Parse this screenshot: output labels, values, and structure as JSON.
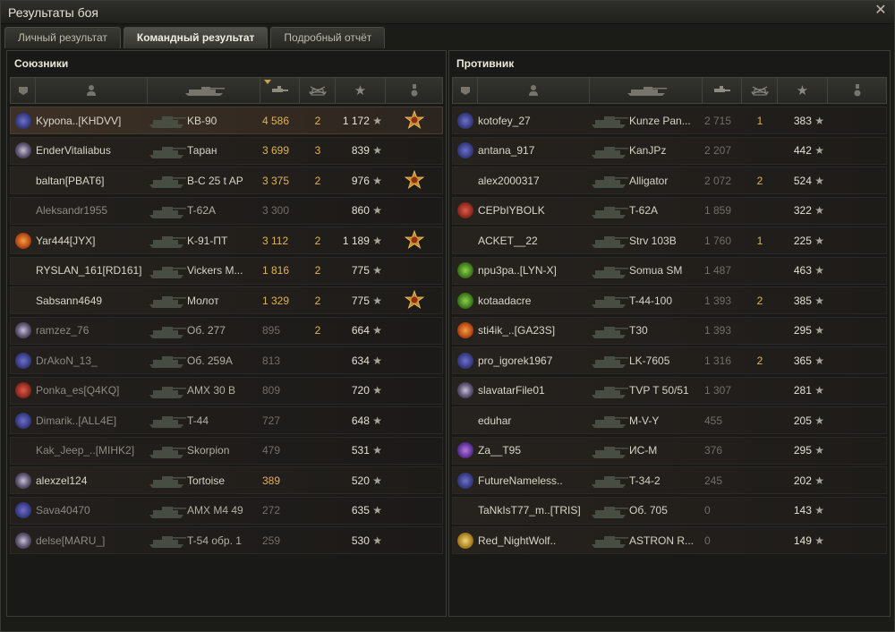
{
  "window": {
    "title": "Результаты боя"
  },
  "tabs": [
    {
      "label": "Личный результат",
      "active": false
    },
    {
      "label": "Командный результат",
      "active": true
    },
    {
      "label": "Подробный отчёт",
      "active": false
    }
  ],
  "colors": {
    "accent": "#e3b34f",
    "highlight": "#3d3126"
  },
  "allies": {
    "title": "Союзники",
    "players": [
      {
        "name": "Kypona..[KHDVV]",
        "tank": "KB-90",
        "damage": "4 586",
        "kills": "2",
        "xp": "1 172",
        "medal": true,
        "badge": "clan",
        "hl": true,
        "dmg_gold": true
      },
      {
        "name": "EnderVitaliabus",
        "tank": "Таран",
        "damage": "3 699",
        "kills": "3",
        "xp": "839",
        "medal": false,
        "badge": "diamond",
        "hl": false,
        "dmg_gold": true
      },
      {
        "name": "baltan[PBAT6]",
        "tank": "B-C 25 t AP",
        "damage": "3 375",
        "kills": "2",
        "xp": "976",
        "medal": true,
        "badge": "",
        "hl": false,
        "dmg_gold": true
      },
      {
        "name": "Aleksandr1955",
        "tank": "T-62A",
        "damage": "3 300",
        "kills": "",
        "xp": "860",
        "medal": false,
        "badge": "",
        "dim": true,
        "dmg_gold": false
      },
      {
        "name": "Yar444[JYX]",
        "tank": "K-91-ПТ",
        "damage": "3 112",
        "kills": "2",
        "xp": "1 189",
        "medal": true,
        "badge": "flame",
        "hl": false,
        "dmg_gold": true
      },
      {
        "name": "RYSLAN_161[RD161]",
        "tank": "Vickers M...",
        "damage": "1 816",
        "kills": "2",
        "xp": "775",
        "medal": false,
        "badge": "",
        "hl": false,
        "dmg_gold": true
      },
      {
        "name": "Sabsann4649",
        "tank": "Молот",
        "damage": "1 329",
        "kills": "2",
        "xp": "775",
        "medal": true,
        "badge": "",
        "hl": false,
        "dmg_gold": true
      },
      {
        "name": "ramzez_76",
        "tank": "Об. 277",
        "damage": "895",
        "kills": "2",
        "xp": "664",
        "medal": false,
        "badge": "diamond",
        "dim": true,
        "red": true,
        "dmg_gold": false
      },
      {
        "name": "DrAkoN_13_",
        "tank": "Об. 259А",
        "damage": "813",
        "kills": "",
        "xp": "634",
        "medal": false,
        "badge": "clan",
        "dim": true,
        "dmg_gold": false
      },
      {
        "name": "Ponka_es[Q4KQ]",
        "tank": "AMX 30 B",
        "damage": "809",
        "kills": "",
        "xp": "720",
        "medal": false,
        "badge": "red",
        "dim": true,
        "red": true,
        "dmg_gold": false
      },
      {
        "name": "Dimarik..[ALL4E]",
        "tank": "T-44",
        "damage": "727",
        "kills": "",
        "xp": "648",
        "medal": false,
        "badge": "clan",
        "dim": true,
        "dmg_gold": false
      },
      {
        "name": "Kak_Jeep_..[MIHK2]",
        "tank": "Skorpion",
        "damage": "479",
        "kills": "",
        "xp": "531",
        "medal": false,
        "badge": "",
        "dim": true,
        "red": true,
        "dmg_gold": false
      },
      {
        "name": "alexzel124",
        "tank": "Tortoise",
        "damage": "389",
        "kills": "",
        "xp": "520",
        "medal": false,
        "badge": "diamond",
        "hl": false,
        "dmg_gold": true
      },
      {
        "name": "Sava40470",
        "tank": "AMX M4 49",
        "damage": "272",
        "kills": "",
        "xp": "635",
        "medal": false,
        "badge": "clan",
        "dim": true,
        "dmg_gold": false
      },
      {
        "name": "delse[MARU_]",
        "tank": "T-54 обр. 1",
        "damage": "259",
        "kills": "",
        "xp": "530",
        "medal": false,
        "badge": "diamond",
        "dim": true,
        "red": true,
        "dmg_gold": false
      }
    ]
  },
  "enemies": {
    "title": "Противник",
    "players": [
      {
        "name": "kotofey_27",
        "tank": "Kunze Pan...",
        "damage": "2 715",
        "kills": "1",
        "xp": "383",
        "badge": "clan"
      },
      {
        "name": "antana_917",
        "tank": "KanJPz",
        "damage": "2 207",
        "kills": "",
        "xp": "442",
        "badge": "clan"
      },
      {
        "name": "alex2000317",
        "tank": "Alligator",
        "damage": "2 072",
        "kills": "2",
        "xp": "524",
        "badge": ""
      },
      {
        "name": "CEPbIYBOLK",
        "tank": "T-62A",
        "damage": "1 859",
        "kills": "",
        "xp": "322",
        "badge": "red"
      },
      {
        "name": "ACKET__22",
        "tank": "Strv 103B",
        "damage": "1 760",
        "kills": "1",
        "xp": "225",
        "badge": ""
      },
      {
        "name": "npu3pa..[LYN-X]",
        "tank": "Somua SM",
        "damage": "1 487",
        "kills": "",
        "xp": "463",
        "badge": "green"
      },
      {
        "name": "kotaadacre",
        "tank": "T-44-100",
        "damage": "1 393",
        "kills": "2",
        "xp": "385",
        "badge": "green"
      },
      {
        "name": "sti4ik_..[GA23S]",
        "tank": "T30",
        "damage": "1 393",
        "kills": "",
        "xp": "295",
        "badge": "flame"
      },
      {
        "name": "pro_igorek1967",
        "tank": "LK-7605",
        "damage": "1 316",
        "kills": "2",
        "xp": "365",
        "badge": "clan"
      },
      {
        "name": "slavatarFile01",
        "tank": "TVP T 50/51",
        "damage": "1 307",
        "kills": "",
        "xp": "281",
        "badge": "diamond"
      },
      {
        "name": "eduhar",
        "tank": "M-V-Y",
        "damage": "455",
        "kills": "",
        "xp": "205",
        "badge": ""
      },
      {
        "name": "Za__T95",
        "tank": "ИС-М",
        "damage": "376",
        "kills": "",
        "xp": "295",
        "badge": "purple"
      },
      {
        "name": "FutureNameless..",
        "tank": "T-34-2",
        "damage": "245",
        "kills": "",
        "xp": "202",
        "badge": "clan"
      },
      {
        "name": "TaNkIsT77_m..[TRIS]",
        "tank": "Об. 705",
        "damage": "0",
        "kills": "",
        "xp": "143",
        "badge": ""
      },
      {
        "name": "Red_NightWolf..",
        "tank": "ASTRON R...",
        "damage": "0",
        "kills": "",
        "xp": "149",
        "badge": "gold"
      }
    ]
  }
}
